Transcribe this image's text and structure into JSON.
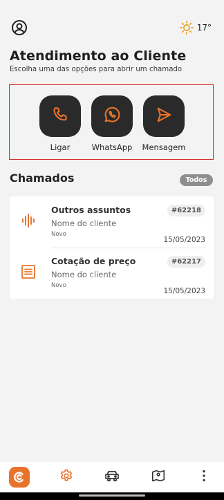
{
  "status": {
    "temperature": "17°",
    "weather_icon": "sun-icon",
    "profile_icon": "user-circle-icon"
  },
  "header": {
    "title": "Atendimento ao Cliente",
    "subtitle": "Escolha uma das opções para abrir um chamado"
  },
  "contact_options": [
    {
      "label": "Ligar",
      "icon": "phone-icon"
    },
    {
      "label": "WhatsApp",
      "icon": "whatsapp-icon"
    },
    {
      "label": "Mensagem",
      "icon": "send-icon"
    }
  ],
  "tickets_section": {
    "title": "Chamados",
    "filter_label": "Todos"
  },
  "tickets": [
    {
      "subject": "Outros assuntos",
      "number": "#62218",
      "client": "Nome do cliente",
      "status": "Novo",
      "date": "15/05/2023",
      "icon": "audio-wave-icon"
    },
    {
      "subject": "Cotação de preço",
      "number": "#62217",
      "client": "Nome do cliente",
      "status": "Novo",
      "date": "15/05/2023",
      "icon": "document-icon"
    }
  ],
  "bottom_nav": [
    {
      "icon": "app-logo-icon"
    },
    {
      "icon": "gear-icon"
    },
    {
      "icon": "car-icon"
    },
    {
      "icon": "map-pin-icon"
    },
    {
      "icon": "more-vertical-icon"
    }
  ],
  "colors": {
    "accent": "#e8742c",
    "highlight_border": "#d42b2b",
    "button_dark": "#2a2a2a",
    "background": "#f3f3f3"
  }
}
